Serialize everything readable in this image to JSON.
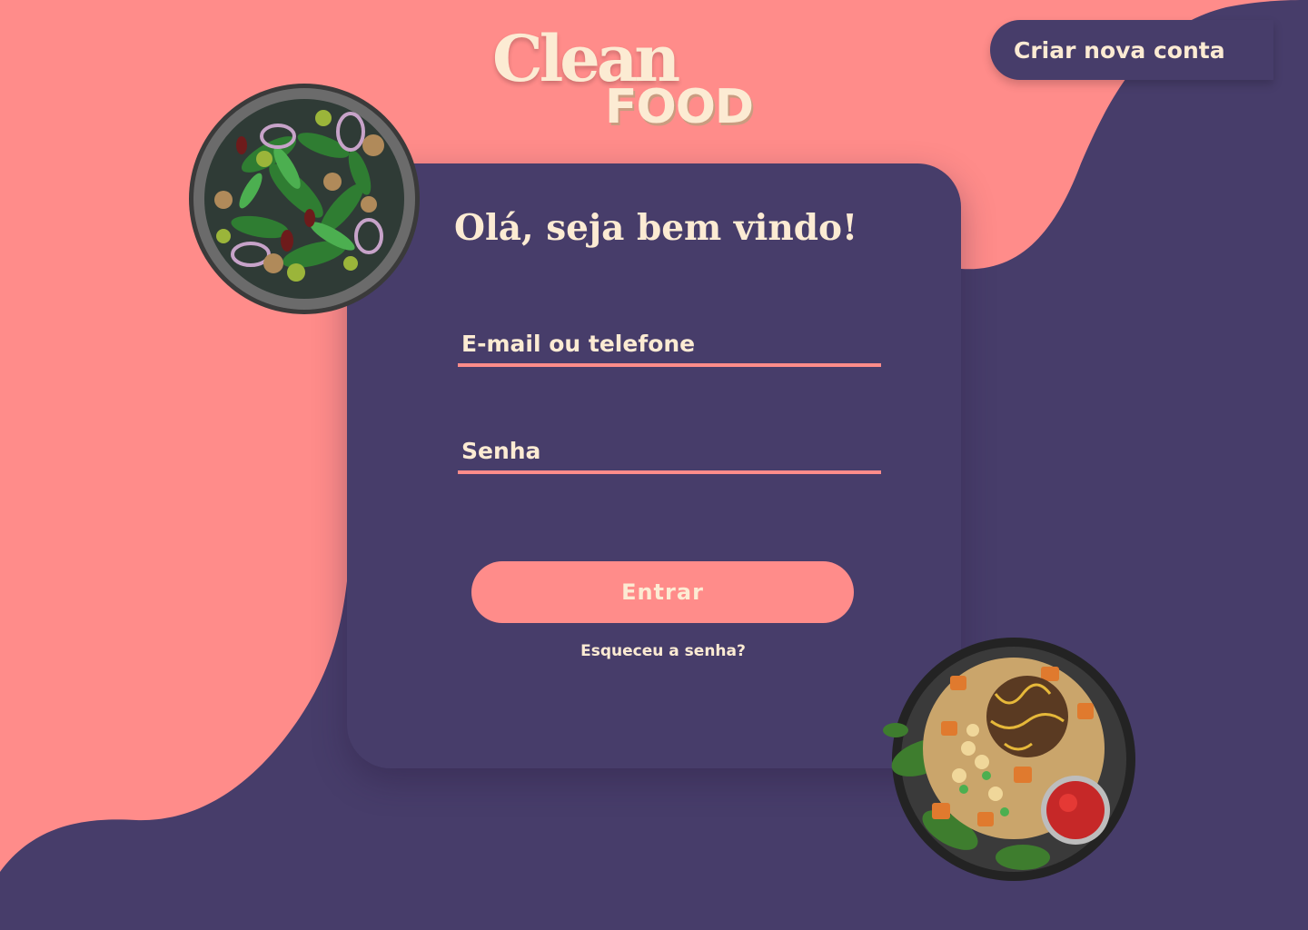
{
  "brand": {
    "logo_line1": "Clean",
    "logo_line2": "FOOD"
  },
  "header": {
    "create_account_label": "Criar nova conta"
  },
  "login_card": {
    "welcome_title": "Olá, seja bem vindo!",
    "email_placeholder": "E-mail ou telefone",
    "email_value": "",
    "password_placeholder": "Senha",
    "password_value": "",
    "submit_label": "Entrar",
    "forgot_password_label": "Esqueceu a senha?"
  },
  "images": {
    "salad_plate": "salad-plate-image",
    "grain_bowl": "grain-bowl-image"
  },
  "colors": {
    "background_coral": "#FF8C8A",
    "purple": "#473D6A",
    "cream_text": "#FCEBD3",
    "accent_line": "#FF8C8A"
  }
}
